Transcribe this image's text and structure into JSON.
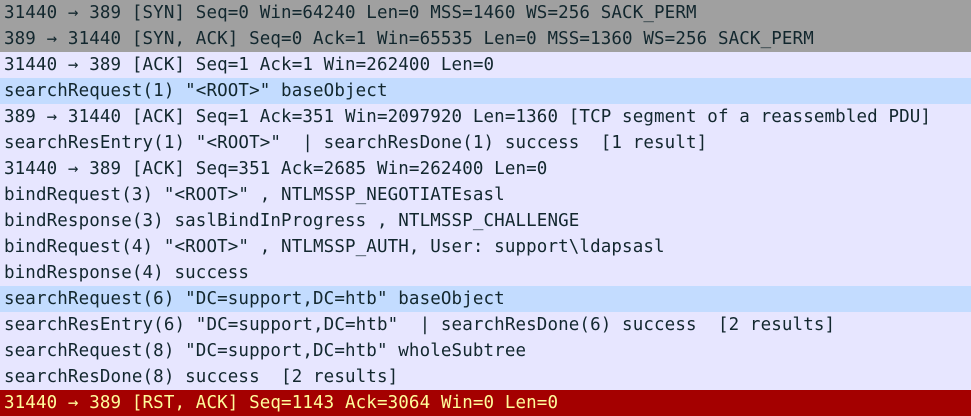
{
  "packet_list": {
    "rows": [
      {
        "info": "31440 → 389 [SYN] Seq=0 Win=64240 Len=0 MSS=1460 WS=256 SACK_PERM",
        "color": "#a0a0a0"
      },
      {
        "info": "389 → 31440 [SYN, ACK] Seq=0 Ack=1 Win=65535 Len=0 MSS=1360 WS=256 SACK_PERM",
        "color": "#a0a0a0"
      },
      {
        "info": "31440 → 389 [ACK] Seq=1 Ack=1 Win=262400 Len=0",
        "color": "#e7e6ff"
      },
      {
        "info": "searchRequest(1) \"<ROOT>\" baseObject",
        "color": "#c3dcff"
      },
      {
        "info": "389 → 31440 [ACK] Seq=1 Ack=351 Win=2097920 Len=1360 [TCP segment of a reassembled PDU]",
        "color": "#e7e6ff"
      },
      {
        "info": "searchResEntry(1) \"<ROOT>\"  | searchResDone(1) success  [1 result]",
        "color": "#e7e6ff"
      },
      {
        "info": "31440 → 389 [ACK] Seq=351 Ack=2685 Win=262400 Len=0",
        "color": "#e7e6ff"
      },
      {
        "info": "bindRequest(3) \"<ROOT>\" , NTLMSSP_NEGOTIATEsasl",
        "color": "#e7e6ff"
      },
      {
        "info": "bindResponse(3) saslBindInProgress , NTLMSSP_CHALLENGE",
        "color": "#e7e6ff"
      },
      {
        "info": "bindRequest(4) \"<ROOT>\" , NTLMSSP_AUTH, User: support\\ldapsasl",
        "color": "#e7e6ff"
      },
      {
        "info": "bindResponse(4) success",
        "color": "#e7e6ff"
      },
      {
        "info": "searchRequest(6) \"DC=support,DC=htb\" baseObject",
        "color": "#c3dcff"
      },
      {
        "info": "searchResEntry(6) \"DC=support,DC=htb\"  | searchResDone(6) success  [2 results]",
        "color": "#e7e6ff"
      },
      {
        "info": "searchRequest(8) \"DC=support,DC=htb\" wholeSubtree",
        "color": "#e7e6ff"
      },
      {
        "info": "searchResDone(8) success  [2 results]",
        "color": "#e7e6ff"
      },
      {
        "info": "31440 → 389 [RST, ACK] Seq=1143 Ack=3064 Win=0 Len=0",
        "color": "#a40000"
      }
    ]
  }
}
